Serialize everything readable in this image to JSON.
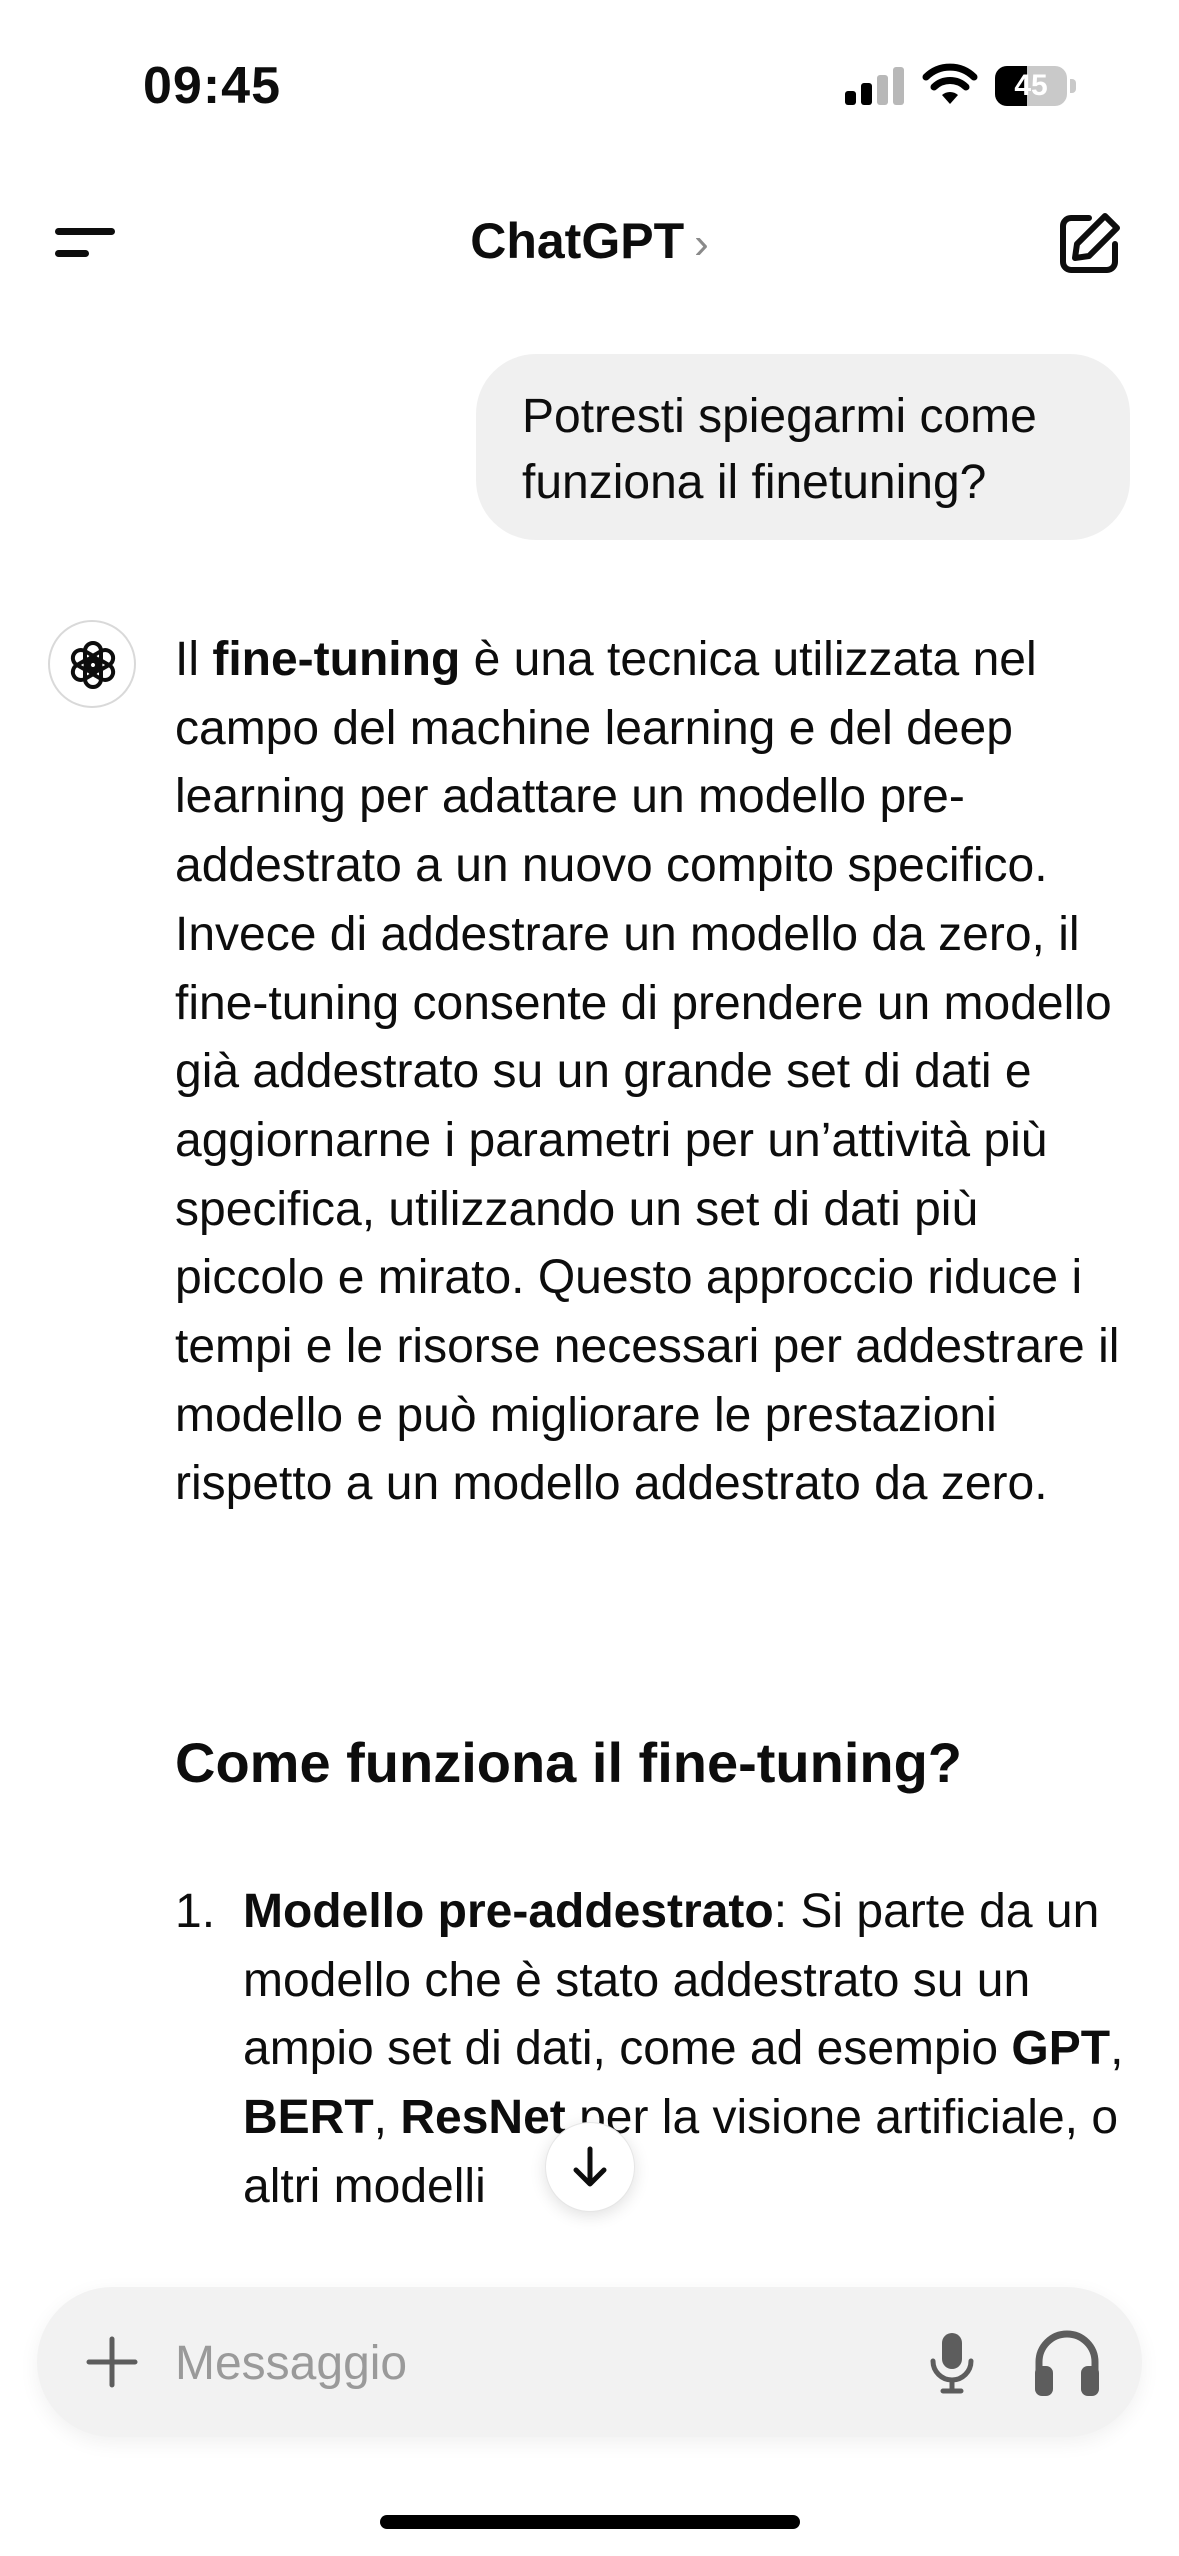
{
  "status_bar": {
    "time": "09:45",
    "battery_level": "45",
    "battery_fraction": 0.45
  },
  "header": {
    "title": "ChatGPT",
    "title_chevron": "›"
  },
  "user_message": {
    "text": "Potresti spiegarmi come funziona il finetuning?"
  },
  "assistant_message": {
    "intro_prefix": "Il ",
    "intro_bold": "fine-tuning",
    "intro_rest": " è una tecnica utilizzata nel campo del machine learning e del deep learning per adattare un modello pre-addestrato a un nuovo compito specifico. Invece di addestrare un modello da zero, il fine-tuning consente di prendere un modello già addestrato su un grande set di dati e aggiornarne i parametri per un’attività più specifica, utilizzando un set di dati più piccolo e mirato. Questo approccio riduce i tempi e le risorse necessari per addestrare il modello e può migliorare le prestazioni rispetto a un modello addestrato da zero.",
    "heading": "Come funziona il fine-tuning?",
    "list": [
      {
        "number": "1.",
        "title": "Modello pre-addestrato",
        "text_a": ": Si parte da un modello che è stato addestrato su un ampio set di dati, come ad esempio ",
        "bold_a": "GPT",
        "sep_a": ", ",
        "bold_b": "BERT",
        "sep_b": ", ",
        "bold_c": "ResNet",
        "text_b": " per la visione artificiale, o altri modelli"
      }
    ]
  },
  "composer": {
    "placeholder": "Messaggio"
  },
  "icons": {
    "menu": "menu-icon",
    "new_chat": "new-chat-icon",
    "avatar": "openai-logo-icon",
    "scroll_down": "arrow-down-icon",
    "plus": "plus-icon",
    "mic": "microphone-icon",
    "voice": "headphones-icon"
  }
}
